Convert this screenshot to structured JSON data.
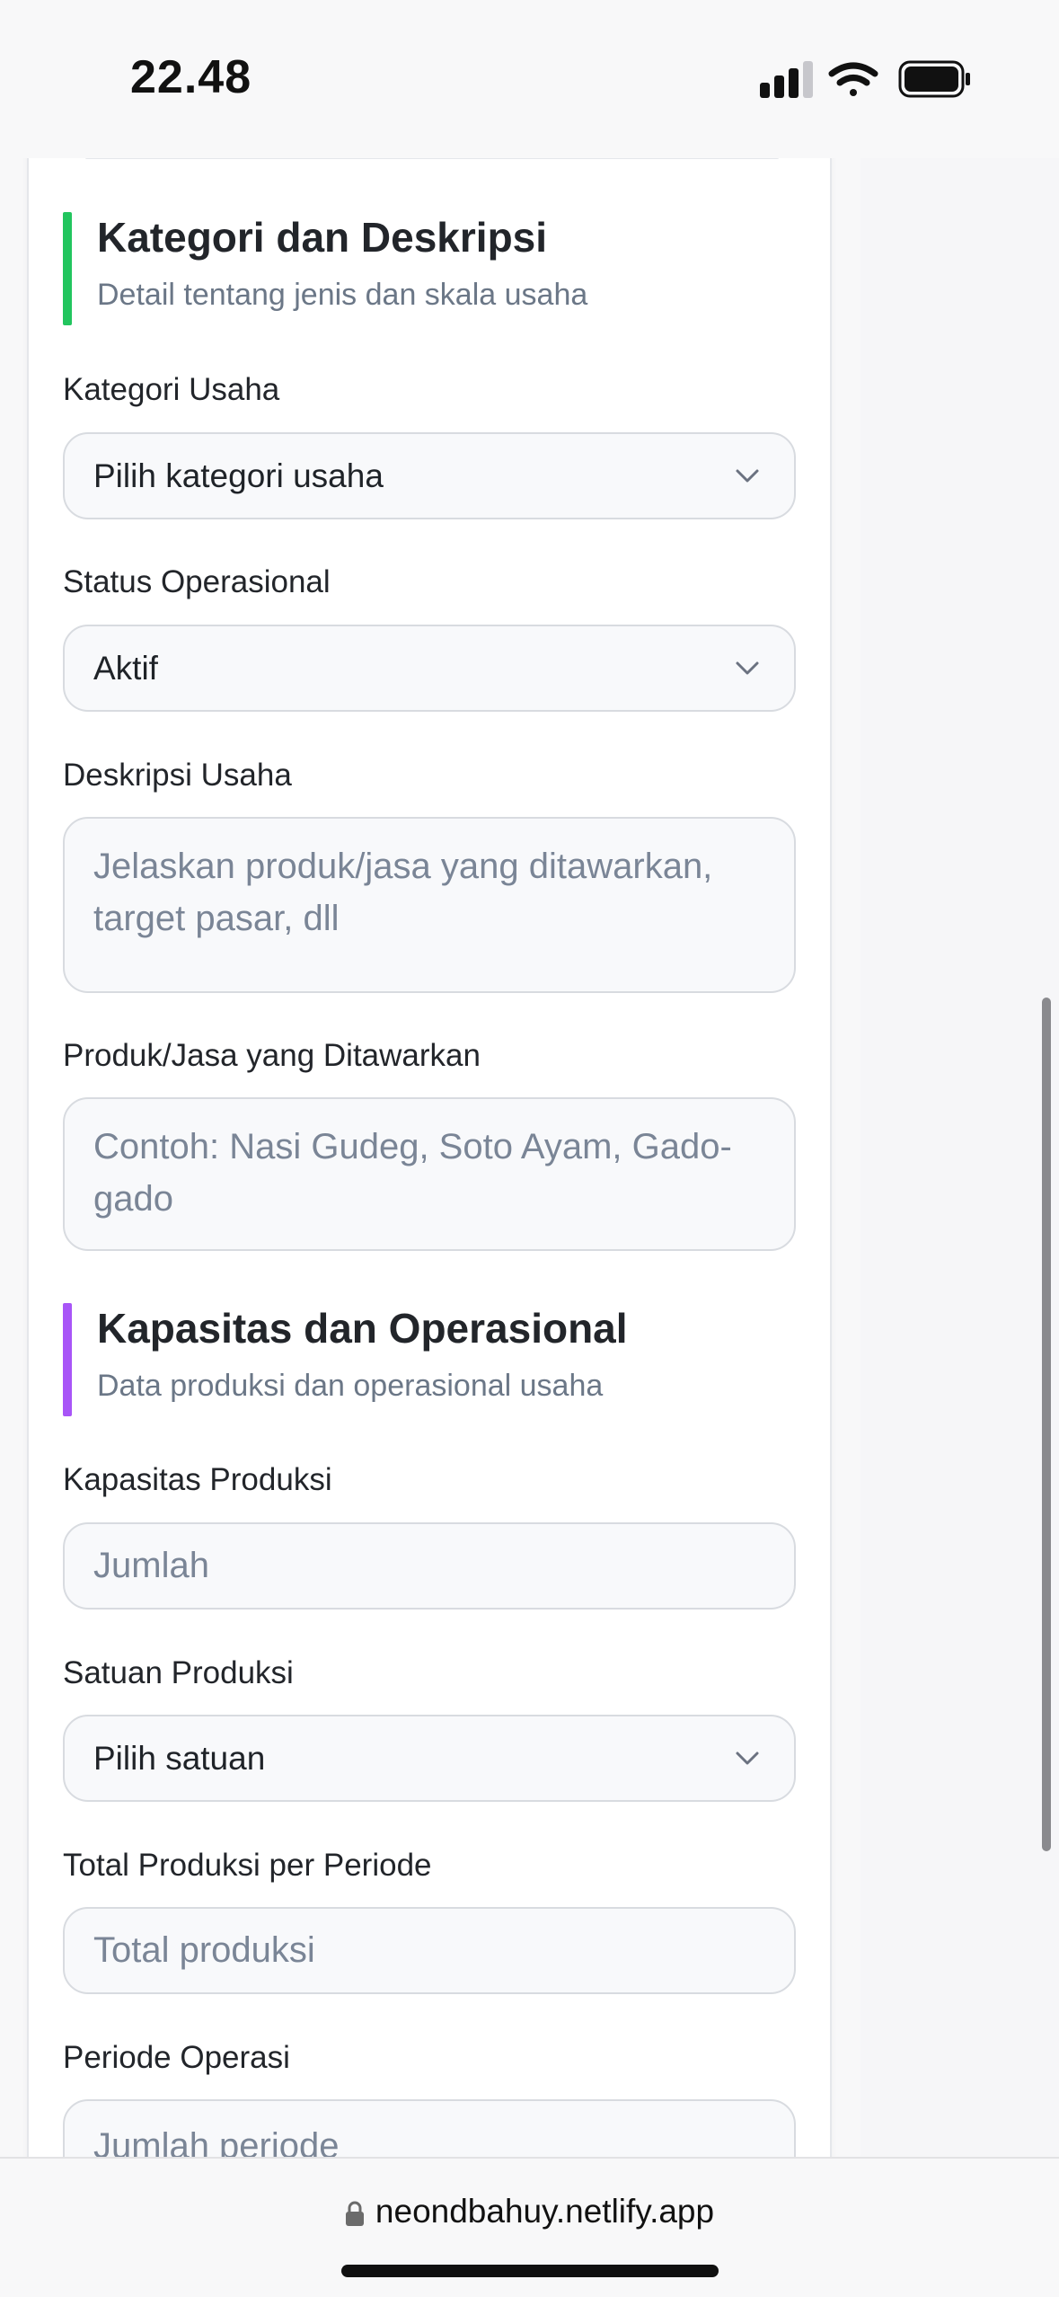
{
  "status_bar": {
    "time": "22.48"
  },
  "sections": [
    {
      "title": "Kategori dan Deskripsi",
      "subtitle": "Detail tentang jenis dan skala usaha",
      "accent": "#22c55e"
    },
    {
      "title": "Kapasitas dan Operasional",
      "subtitle": "Data produksi dan operasional usaha",
      "accent": "#a855f7"
    }
  ],
  "fields": {
    "kategori_usaha": {
      "label": "Kategori Usaha",
      "value": "Pilih kategori usaha"
    },
    "status_operasional": {
      "label": "Status Operasional",
      "value": "Aktif"
    },
    "deskripsi_usaha": {
      "label": "Deskripsi Usaha",
      "placeholder": "Jelaskan produk/jasa yang ditawarkan, target pasar, dll"
    },
    "produk_jasa": {
      "label": "Produk/Jasa yang Ditawarkan",
      "placeholder": "Contoh: Nasi Gudeg, Soto Ayam, Gado-gado"
    },
    "kapasitas_produksi": {
      "label": "Kapasitas Produksi",
      "placeholder": "Jumlah"
    },
    "satuan_produksi": {
      "label": "Satuan Produksi",
      "value": "Pilih satuan"
    },
    "total_produksi": {
      "label": "Total Produksi per Periode",
      "placeholder": "Total produksi"
    },
    "periode_operasi": {
      "label": "Periode Operasi",
      "placeholder": "Jumlah periode"
    }
  },
  "browser": {
    "url": "neondbahuy.netlify.app"
  },
  "icons": [
    "signal-icon",
    "wifi-icon",
    "battery-icon",
    "chevron-down-icon",
    "lock-icon"
  ]
}
